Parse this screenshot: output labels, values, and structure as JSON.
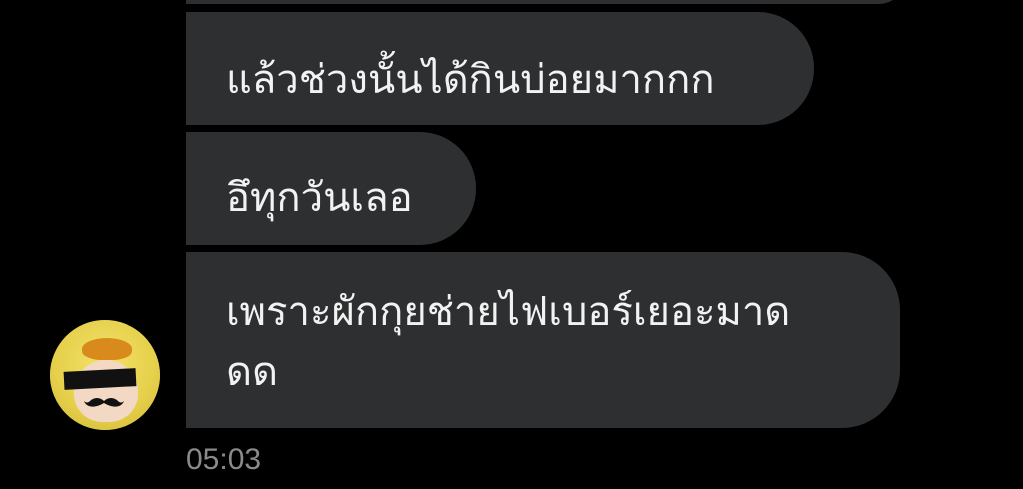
{
  "messages": [
    {
      "text": "แล้วช่วงนั้นได้กินบ่อยมากกก"
    },
    {
      "text": "อึทุกวันเลอ"
    },
    {
      "text": "เพราะผักกุยช่ายไฟเบอร์เยอะมาด ดด"
    }
  ],
  "timestamp": "05:03",
  "colors": {
    "background": "#000000",
    "bubble": "#2d2f31",
    "text": "#f2f2f2",
    "timestamp": "#8a8a8a",
    "avatar_hood": "#e9d65a"
  },
  "icons": {
    "avatar": "duck-hood-avatar-icon"
  }
}
